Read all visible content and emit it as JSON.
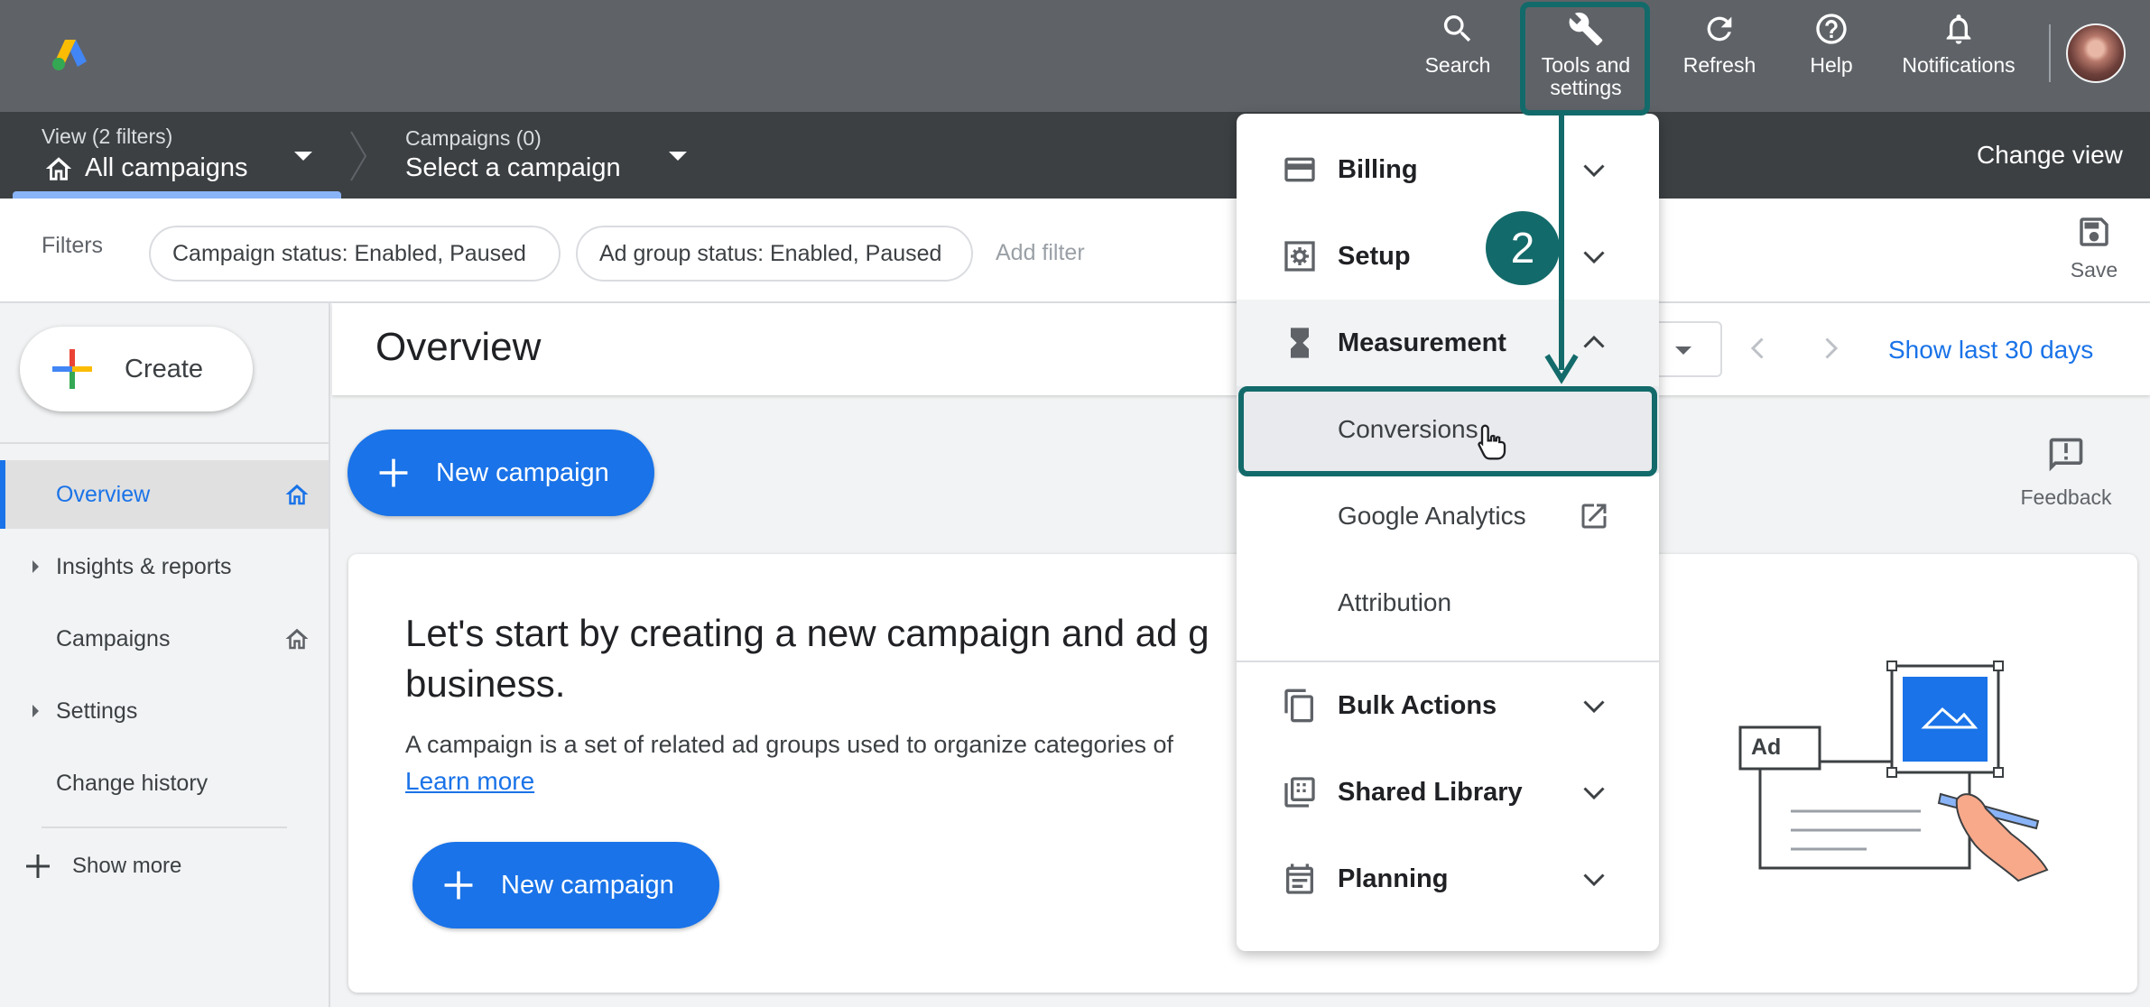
{
  "topbar": {
    "search_label": "Search",
    "tools_label_line1": "Tools and",
    "tools_label_line2": "settings",
    "refresh_label": "Refresh",
    "help_label": "Help",
    "notifications_label": "Notifications"
  },
  "viewbar": {
    "view_small": "View (2 filters)",
    "view_big": "All campaigns",
    "campaigns_small": "Campaigns (0)",
    "campaigns_big": "Select a campaign",
    "change_view": "Change view"
  },
  "filters": {
    "label": "Filters",
    "chips": [
      "Campaign status: Enabled, Paused",
      "Ad group status: Enabled, Paused"
    ],
    "add_filter": "Add filter",
    "save_label": "Save"
  },
  "sidebar": {
    "create_label": "Create",
    "items": [
      {
        "label": "Overview"
      },
      {
        "label": "Insights & reports"
      },
      {
        "label": "Campaigns"
      },
      {
        "label": "Settings"
      },
      {
        "label": "Change history"
      }
    ],
    "show_more": "Show more"
  },
  "main": {
    "title": "Overview",
    "show_last": "Show last 30 days",
    "new_campaign": "New campaign",
    "feedback": "Feedback",
    "card_headline_line1": "Let's start by creating a new campaign and ad g",
    "card_headline_line2": "business.",
    "card_desc": "A campaign is a set of related ad groups used to organize categories of",
    "learn_more": "Learn more",
    "ad_label": "Ad"
  },
  "menu": {
    "billing": "Billing",
    "setup": "Setup",
    "measurement": "Measurement",
    "conversions": "Conversions",
    "google_analytics": "Google Analytics",
    "attribution": "Attribution",
    "bulk_actions": "Bulk Actions",
    "shared_library": "Shared Library",
    "planning": "Planning"
  },
  "annotation": {
    "step_number": "2"
  },
  "colors": {
    "topbar": "#5f6368",
    "viewbar": "#3c4043",
    "accent_blue": "#1a73e8",
    "annotation_teal": "#136a6a"
  }
}
